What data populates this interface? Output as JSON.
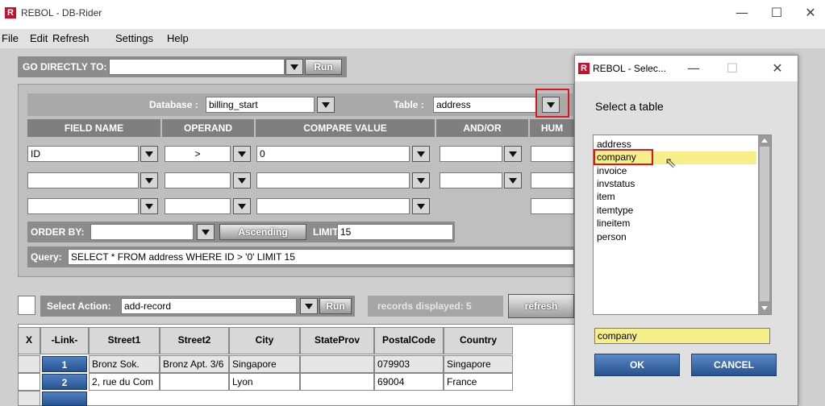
{
  "window": {
    "title": "REBOL - DB-Rider",
    "logo": "R"
  },
  "menu": [
    "File",
    "Edit",
    "Refresh",
    "Settings",
    "Help"
  ],
  "goto": {
    "label": "GO DIRECTLY TO:",
    "value": "",
    "run_label": "Run"
  },
  "query": {
    "database_label": "Database :",
    "database_value": "billing_start",
    "table_label": "Table :",
    "table_value": "address",
    "headers": [
      "FIELD NAME",
      "OPERAND",
      "COMPARE VALUE",
      "AND/OR",
      "HUM"
    ],
    "rows": [
      {
        "field": "ID",
        "operand": ">",
        "compare": "0",
        "andor": ""
      },
      {
        "field": "",
        "operand": "",
        "compare": "",
        "andor": ""
      },
      {
        "field": "",
        "operand": "",
        "compare": "",
        "andor": ""
      }
    ],
    "order_by_label": "ORDER BY:",
    "order_by_value": "",
    "ascending_label": "Ascending",
    "limit_label": "LIMIT:",
    "limit_value": "15",
    "query_label": "Query:",
    "query_text": "SELECT * FROM address WHERE ID > '0'  LIMIT 15"
  },
  "actions": {
    "select_action_label": "Select Action:",
    "select_action_value": "add-record",
    "run_label": "Run",
    "records_label": "records displayed: 5",
    "refresh_label": "refresh"
  },
  "table": {
    "columns": [
      "X",
      "-Link-",
      "Street1",
      "Street2",
      "City",
      "StateProv",
      "PostalCode",
      "Country"
    ],
    "rows": [
      {
        "link": "1",
        "street1": "Bronz Sok.",
        "street2": "Bronz Apt. 3/6",
        "city": "Singapore",
        "stateprov": "",
        "postal": "079903",
        "country": "Singapore"
      },
      {
        "link": "2",
        "street1": "2, rue du Com",
        "street2": "",
        "city": "Lyon",
        "stateprov": "",
        "postal": "69004",
        "country": "France"
      }
    ]
  },
  "dialog": {
    "title": "REBOL - Selec...",
    "prompt": "Select a table",
    "items": [
      "address",
      "company",
      "invoice",
      "invstatus",
      "item",
      "itemtype",
      "lineitem",
      "person"
    ],
    "selected": "company",
    "selection_field": "company",
    "ok_label": "OK",
    "cancel_label": "CANCEL"
  },
  "colors": {
    "accent_red": "#e0141e",
    "selection_yellow": "#f7ef8a",
    "link_blue": "#2e5c9e"
  }
}
